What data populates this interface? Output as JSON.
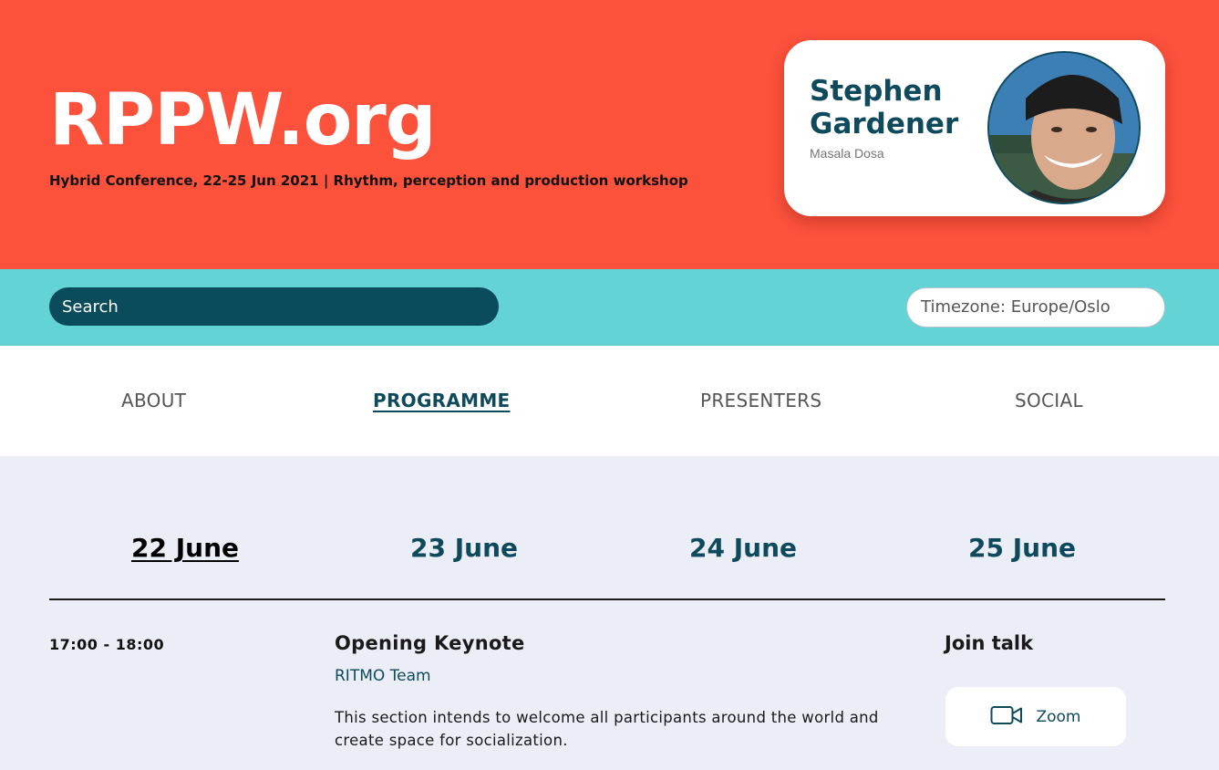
{
  "header": {
    "title": "RPPW.org",
    "subtitle": "Hybrid Conference, 22-25 Jun 2021 | Rhythm, perception and production workshop",
    "background": "#fc523c"
  },
  "profile": {
    "name": "Stephen Gardener",
    "subtitle": "Masala Dosa"
  },
  "toolbar": {
    "search_placeholder": "Search",
    "timezone": "Timezone: Europe/Oslo",
    "background": "#63d3d6"
  },
  "nav": {
    "items": [
      {
        "label": "ABOUT",
        "active": false
      },
      {
        "label": "PROGRAMME",
        "active": true
      },
      {
        "label": "PRESENTERS",
        "active": false
      },
      {
        "label": "SOCIAL",
        "active": false
      }
    ]
  },
  "days": [
    {
      "label": "22 June",
      "active": true
    },
    {
      "label": "23 June",
      "active": false
    },
    {
      "label": "24 June",
      "active": false
    },
    {
      "label": "25 June",
      "active": false
    }
  ],
  "session": {
    "time": "17:00 - 18:00",
    "title": "Opening Keynote",
    "author": "RITMO Team",
    "description": "This section intends to welcome all participants around the world and create space for socialization.",
    "join_heading": "Join talk",
    "join_button_label": "Zoom",
    "join_button_icon": "video-camera-icon"
  },
  "colors": {
    "accent": "#0e4a5c",
    "page_background": "#eceef7"
  }
}
